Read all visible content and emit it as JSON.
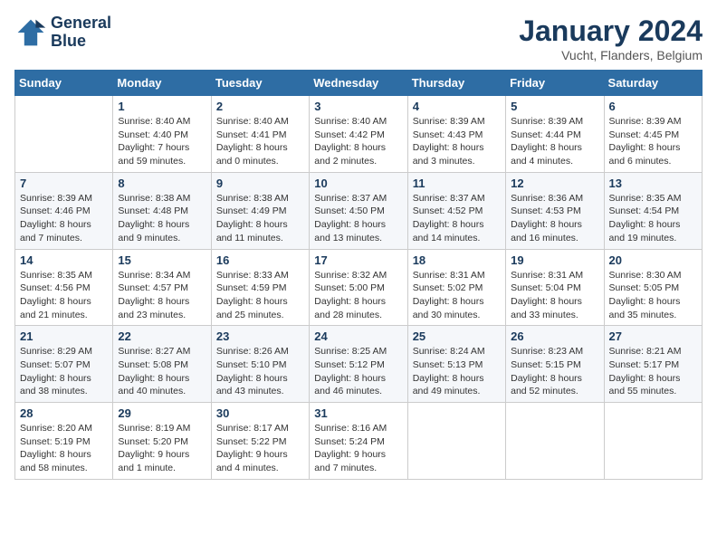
{
  "header": {
    "logo_line1": "General",
    "logo_line2": "Blue",
    "month": "January 2024",
    "location": "Vucht, Flanders, Belgium"
  },
  "days_of_week": [
    "Sunday",
    "Monday",
    "Tuesday",
    "Wednesday",
    "Thursday",
    "Friday",
    "Saturday"
  ],
  "weeks": [
    [
      {
        "day": "",
        "info": ""
      },
      {
        "day": "1",
        "info": "Sunrise: 8:40 AM\nSunset: 4:40 PM\nDaylight: 7 hours\nand 59 minutes."
      },
      {
        "day": "2",
        "info": "Sunrise: 8:40 AM\nSunset: 4:41 PM\nDaylight: 8 hours\nand 0 minutes."
      },
      {
        "day": "3",
        "info": "Sunrise: 8:40 AM\nSunset: 4:42 PM\nDaylight: 8 hours\nand 2 minutes."
      },
      {
        "day": "4",
        "info": "Sunrise: 8:39 AM\nSunset: 4:43 PM\nDaylight: 8 hours\nand 3 minutes."
      },
      {
        "day": "5",
        "info": "Sunrise: 8:39 AM\nSunset: 4:44 PM\nDaylight: 8 hours\nand 4 minutes."
      },
      {
        "day": "6",
        "info": "Sunrise: 8:39 AM\nSunset: 4:45 PM\nDaylight: 8 hours\nand 6 minutes."
      }
    ],
    [
      {
        "day": "7",
        "info": "Sunrise: 8:39 AM\nSunset: 4:46 PM\nDaylight: 8 hours\nand 7 minutes."
      },
      {
        "day": "8",
        "info": "Sunrise: 8:38 AM\nSunset: 4:48 PM\nDaylight: 8 hours\nand 9 minutes."
      },
      {
        "day": "9",
        "info": "Sunrise: 8:38 AM\nSunset: 4:49 PM\nDaylight: 8 hours\nand 11 minutes."
      },
      {
        "day": "10",
        "info": "Sunrise: 8:37 AM\nSunset: 4:50 PM\nDaylight: 8 hours\nand 13 minutes."
      },
      {
        "day": "11",
        "info": "Sunrise: 8:37 AM\nSunset: 4:52 PM\nDaylight: 8 hours\nand 14 minutes."
      },
      {
        "day": "12",
        "info": "Sunrise: 8:36 AM\nSunset: 4:53 PM\nDaylight: 8 hours\nand 16 minutes."
      },
      {
        "day": "13",
        "info": "Sunrise: 8:35 AM\nSunset: 4:54 PM\nDaylight: 8 hours\nand 19 minutes."
      }
    ],
    [
      {
        "day": "14",
        "info": "Sunrise: 8:35 AM\nSunset: 4:56 PM\nDaylight: 8 hours\nand 21 minutes."
      },
      {
        "day": "15",
        "info": "Sunrise: 8:34 AM\nSunset: 4:57 PM\nDaylight: 8 hours\nand 23 minutes."
      },
      {
        "day": "16",
        "info": "Sunrise: 8:33 AM\nSunset: 4:59 PM\nDaylight: 8 hours\nand 25 minutes."
      },
      {
        "day": "17",
        "info": "Sunrise: 8:32 AM\nSunset: 5:00 PM\nDaylight: 8 hours\nand 28 minutes."
      },
      {
        "day": "18",
        "info": "Sunrise: 8:31 AM\nSunset: 5:02 PM\nDaylight: 8 hours\nand 30 minutes."
      },
      {
        "day": "19",
        "info": "Sunrise: 8:31 AM\nSunset: 5:04 PM\nDaylight: 8 hours\nand 33 minutes."
      },
      {
        "day": "20",
        "info": "Sunrise: 8:30 AM\nSunset: 5:05 PM\nDaylight: 8 hours\nand 35 minutes."
      }
    ],
    [
      {
        "day": "21",
        "info": "Sunrise: 8:29 AM\nSunset: 5:07 PM\nDaylight: 8 hours\nand 38 minutes."
      },
      {
        "day": "22",
        "info": "Sunrise: 8:27 AM\nSunset: 5:08 PM\nDaylight: 8 hours\nand 40 minutes."
      },
      {
        "day": "23",
        "info": "Sunrise: 8:26 AM\nSunset: 5:10 PM\nDaylight: 8 hours\nand 43 minutes."
      },
      {
        "day": "24",
        "info": "Sunrise: 8:25 AM\nSunset: 5:12 PM\nDaylight: 8 hours\nand 46 minutes."
      },
      {
        "day": "25",
        "info": "Sunrise: 8:24 AM\nSunset: 5:13 PM\nDaylight: 8 hours\nand 49 minutes."
      },
      {
        "day": "26",
        "info": "Sunrise: 8:23 AM\nSunset: 5:15 PM\nDaylight: 8 hours\nand 52 minutes."
      },
      {
        "day": "27",
        "info": "Sunrise: 8:21 AM\nSunset: 5:17 PM\nDaylight: 8 hours\nand 55 minutes."
      }
    ],
    [
      {
        "day": "28",
        "info": "Sunrise: 8:20 AM\nSunset: 5:19 PM\nDaylight: 8 hours\nand 58 minutes."
      },
      {
        "day": "29",
        "info": "Sunrise: 8:19 AM\nSunset: 5:20 PM\nDaylight: 9 hours\nand 1 minute."
      },
      {
        "day": "30",
        "info": "Sunrise: 8:17 AM\nSunset: 5:22 PM\nDaylight: 9 hours\nand 4 minutes."
      },
      {
        "day": "31",
        "info": "Sunrise: 8:16 AM\nSunset: 5:24 PM\nDaylight: 9 hours\nand 7 minutes."
      },
      {
        "day": "",
        "info": ""
      },
      {
        "day": "",
        "info": ""
      },
      {
        "day": "",
        "info": ""
      }
    ]
  ]
}
